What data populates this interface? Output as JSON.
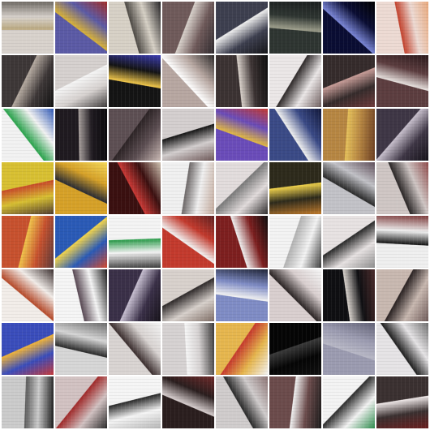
{
  "grid": {
    "rows": 8,
    "cols": 8,
    "tiles": [
      {
        "base": "#d8d2cc",
        "accent": "#b9a77e",
        "dark": "#6f6a64"
      },
      {
        "base": "#5b5aa5",
        "accent": "#d7b13a",
        "dark": "#a22f2a"
      },
      {
        "base": "#d7d1c6",
        "accent": "#4f4b46",
        "dark": "#262426"
      },
      {
        "base": "#6f5a5a",
        "accent": "#d8d1cb",
        "dark": "#2f2a2e"
      },
      {
        "base": "#3d3f4f",
        "accent": "#f0f0f0",
        "dark": "#151518"
      },
      {
        "base": "#2e3531",
        "accent": "#a0a18e",
        "dark": "#1b1f1f"
      },
      {
        "base": "#0a0d33",
        "accent": "#7a86d6",
        "dark": "#000000"
      },
      {
        "base": "#eddad3",
        "accent": "#c3432e",
        "dark": "#e8a87c"
      },
      {
        "base": "#3d3737",
        "accent": "#b6aba1",
        "dark": "#121212"
      },
      {
        "base": "#d6d1cf",
        "accent": "#f5f5f5",
        "dark": "#3d3a3a"
      },
      {
        "base": "#141414",
        "accent": "#f2c84b",
        "dark": "#3a3cb0"
      },
      {
        "base": "#b7a7a1",
        "accent": "#ffffff",
        "dark": "#2b2828"
      },
      {
        "base": "#3b3232",
        "accent": "#d9d1ca",
        "dark": "#0d0d0d"
      },
      {
        "base": "#ebe7e7",
        "accent": "#2f2a2a",
        "dark": "#6d5d5d"
      },
      {
        "base": "#352b2b",
        "accent": "#c89d98",
        "dark": "#6e3a3a"
      },
      {
        "base": "#5c3d3f",
        "accent": "#e7e1de",
        "dark": "#2b1a1c"
      },
      {
        "base": "#f2f2f2",
        "accent": "#2aa34c",
        "dark": "#2f58b7"
      },
      {
        "base": "#1f1a20",
        "accent": "#a79f9c",
        "dark": "#0c0b0e"
      },
      {
        "base": "#5d4f53",
        "accent": "#2d2426",
        "dark": "#cbbab5"
      },
      {
        "base": "#d4cfcf",
        "accent": "#161616",
        "dark": "#6b5555"
      },
      {
        "base": "#6a4cb9",
        "accent": "#e0b744",
        "dark": "#c33a33"
      },
      {
        "base": "#3a4a86",
        "accent": "#f0f0f0",
        "dark": "#12183a"
      },
      {
        "base": "#b68642",
        "accent": "#e5c05a",
        "dark": "#6b3e22"
      },
      {
        "base": "#3e3645",
        "accent": "#c8c0cd",
        "dark": "#151219"
      },
      {
        "base": "#d8c032",
        "accent": "#c84b2a",
        "dark": "#4e3a2e"
      },
      {
        "base": "#d6a128",
        "accent": "#2b2c33",
        "dark": "#f4d85a"
      },
      {
        "base": "#3a1010",
        "accent": "#c93935",
        "dark": "#d0c3b2"
      },
      {
        "base": "#f0f0f0",
        "accent": "#6f6a6a",
        "dark": "#c2a99c"
      },
      {
        "base": "#e2dcdc",
        "accent": "#7a7a7a",
        "dark": "#2d2b2b"
      },
      {
        "base": "#2d2a1b",
        "accent": "#f0d24b",
        "dark": "#c07a2b"
      },
      {
        "base": "#c2c2c7",
        "accent": "#2a2a2a",
        "dark": "#5f4e5a"
      },
      {
        "base": "#cfc6c4",
        "accent": "#2b2727",
        "dark": "#8e4a4a"
      },
      {
        "base": "#c7512e",
        "accent": "#f0c24b",
        "dark": "#5a3b3b"
      },
      {
        "base": "#2a5ab6",
        "accent": "#f3d54c",
        "dark": "#d24a2f"
      },
      {
        "base": "#f4f4f4",
        "accent": "#2b9c4b",
        "dark": "#3a3a3a"
      },
      {
        "base": "#c33a2d",
        "accent": "#f3f3f3",
        "dark": "#5d2121"
      },
      {
        "base": "#7d1f1f",
        "accent": "#f0efef",
        "dark": "#0d0d0d"
      },
      {
        "base": "#f3f3f3",
        "accent": "#b3b3b3",
        "dark": "#3a3a3a"
      },
      {
        "base": "#e7e2e2",
        "accent": "#2b2b2b",
        "dark": "#8c8c8c"
      },
      {
        "base": "#efefef",
        "accent": "#161616",
        "dark": "#7c3a3a"
      },
      {
        "base": "#f2ede9",
        "accent": "#b64a2a",
        "dark": "#3b2f2f"
      },
      {
        "base": "#f5f5f5",
        "accent": "#5a4a55",
        "dark": "#1d1d1d"
      },
      {
        "base": "#3a3048",
        "accent": "#c7bfd1",
        "dark": "#161219"
      },
      {
        "base": "#d8d1cc",
        "accent": "#2f2a2a",
        "dark": "#7e6c64"
      },
      {
        "base": "#7f8cc5",
        "accent": "#f3f3f3",
        "dark": "#1f2436"
      },
      {
        "base": "#d9cfcf",
        "accent": "#2b2424",
        "dark": "#f6f6f6"
      },
      {
        "base": "#0f0f12",
        "accent": "#d7d1cb",
        "dark": "#4a2a2a"
      },
      {
        "base": "#c8b8b0",
        "accent": "#2a2222",
        "dark": "#6e5a58"
      },
      {
        "base": "#3a4dbb",
        "accent": "#f0b43b",
        "dark": "#c63a3a"
      },
      {
        "base": "#d6d6d6",
        "accent": "#2b2b2b",
        "dark": "#6b6b6b"
      },
      {
        "base": "#d9d4d2",
        "accent": "#3b2e2e",
        "dark": "#f2f2f2"
      },
      {
        "base": "#d6d2d2",
        "accent": "#f5f5f5",
        "dark": "#3a3838"
      },
      {
        "base": "#e6b64e",
        "accent": "#c63a2d",
        "dark": "#f2f2f2"
      },
      {
        "base": "#050505",
        "accent": "#3a3a3a",
        "dark": "#111111"
      },
      {
        "base": "#9b9bb0",
        "accent": "#b8b8c6",
        "dark": "#616175"
      },
      {
        "base": "#e6e4e6",
        "accent": "#1f1f1f",
        "dark": "#6e6e6e"
      },
      {
        "base": "#cbcbcb",
        "accent": "#5b5b5b",
        "dark": "#1b1b1b"
      },
      {
        "base": "#d2c2c2",
        "accent": "#a12a2a",
        "dark": "#2a2a2a"
      },
      {
        "base": "#f5f5f5",
        "accent": "#2a2a2a",
        "dark": "#b5b5b5"
      },
      {
        "base": "#2a1e1e",
        "accent": "#d8cfcf",
        "dark": "#6e2a2a"
      },
      {
        "base": "#d0cccc",
        "accent": "#2a2a2a",
        "dark": "#8c7474"
      },
      {
        "base": "#6b4b4b",
        "accent": "#f2f2f2",
        "dark": "#1b1b1b"
      },
      {
        "base": "#f3f3f3",
        "accent": "#2e2e2e",
        "dark": "#2b8b4b"
      },
      {
        "base": "#3a3030",
        "accent": "#efe8e8",
        "dark": "#6a1f1f"
      }
    ]
  }
}
